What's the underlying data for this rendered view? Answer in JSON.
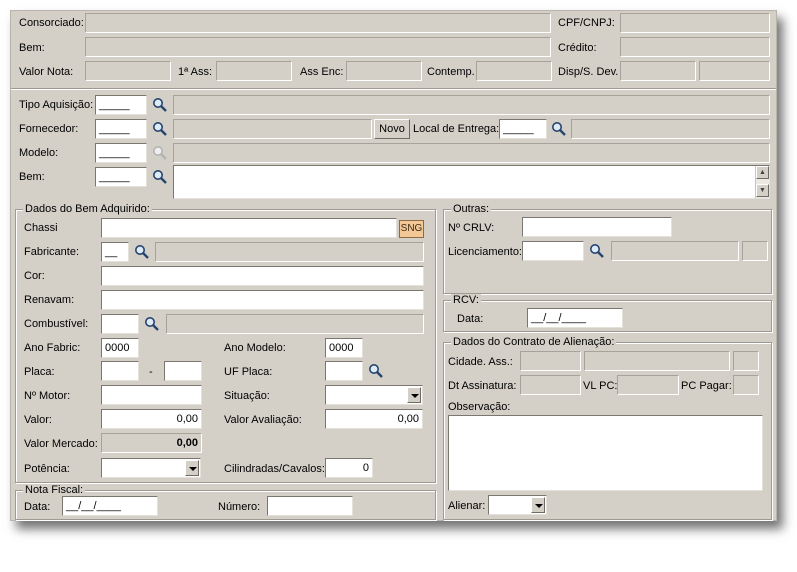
{
  "header": {
    "consorciado": "Consorciado:",
    "cpf": "CPF/CNPJ:",
    "bem": "Bem:",
    "credito": "Crédito:",
    "valor_nota": "Valor Nota:",
    "ass1": "1ª Ass:",
    "ass_enc": "Ass Enc:",
    "contemp": "Contemp.",
    "disp": "Disp/S. Dev."
  },
  "acq": {
    "tipo": "Tipo Aquisição:",
    "fornecedor": "Fornecedor:",
    "novo": "Novo",
    "local": "Local de Entrega:",
    "modelo": "Modelo:",
    "bem": "Bem:",
    "blank": "_____"
  },
  "dados": {
    "title": "Dados do Bem Adquirido:",
    "chassi": "Chassi",
    "sng": "SNG",
    "fabricante": "Fabricante:",
    "fab_blank": "__",
    "cor": "Cor:",
    "renavam": "Renavam:",
    "combustivel": "Combustível:",
    "ano_fabric": "Ano Fabric:",
    "ano_fabric_val": "0000",
    "ano_modelo": "Ano Modelo:",
    "ano_modelo_val": "0000",
    "placa": "Placa:",
    "dash": "-",
    "uf_placa": "UF Placa:",
    "motor": "Nº Motor:",
    "situacao": "Situação:",
    "valor": "Valor:",
    "valor_val": "0,00",
    "valor_aval": "Valor Avaliação:",
    "valor_aval_val": "0,00",
    "valor_mercado": "Valor Mercado:",
    "valor_mercado_val": "0,00",
    "potencia": "Potência:",
    "cilindradas": "Cilindradas/Cavalos:",
    "cilindradas_val": "0"
  },
  "nota": {
    "title": "Nota Fiscal:",
    "data": "Data:",
    "data_val": "__/__/____",
    "numero": "Número:"
  },
  "outras": {
    "title": "Outras:",
    "crlv": "Nº  CRLV:",
    "licenciamento": "Licenciamento:"
  },
  "rcv": {
    "title": "RCV:",
    "data": "Data:",
    "data_val": "__/__/____"
  },
  "contrato": {
    "title": "Dados do Contrato de Alienação:",
    "cidade": "Cidade. Ass.:",
    "dt_ass": "Dt Assinatura:",
    "vl_pc": "VL PC:",
    "pc_pagar": "PC Pagar:",
    "observacao": "Observação:",
    "alienar": "Alienar:"
  }
}
